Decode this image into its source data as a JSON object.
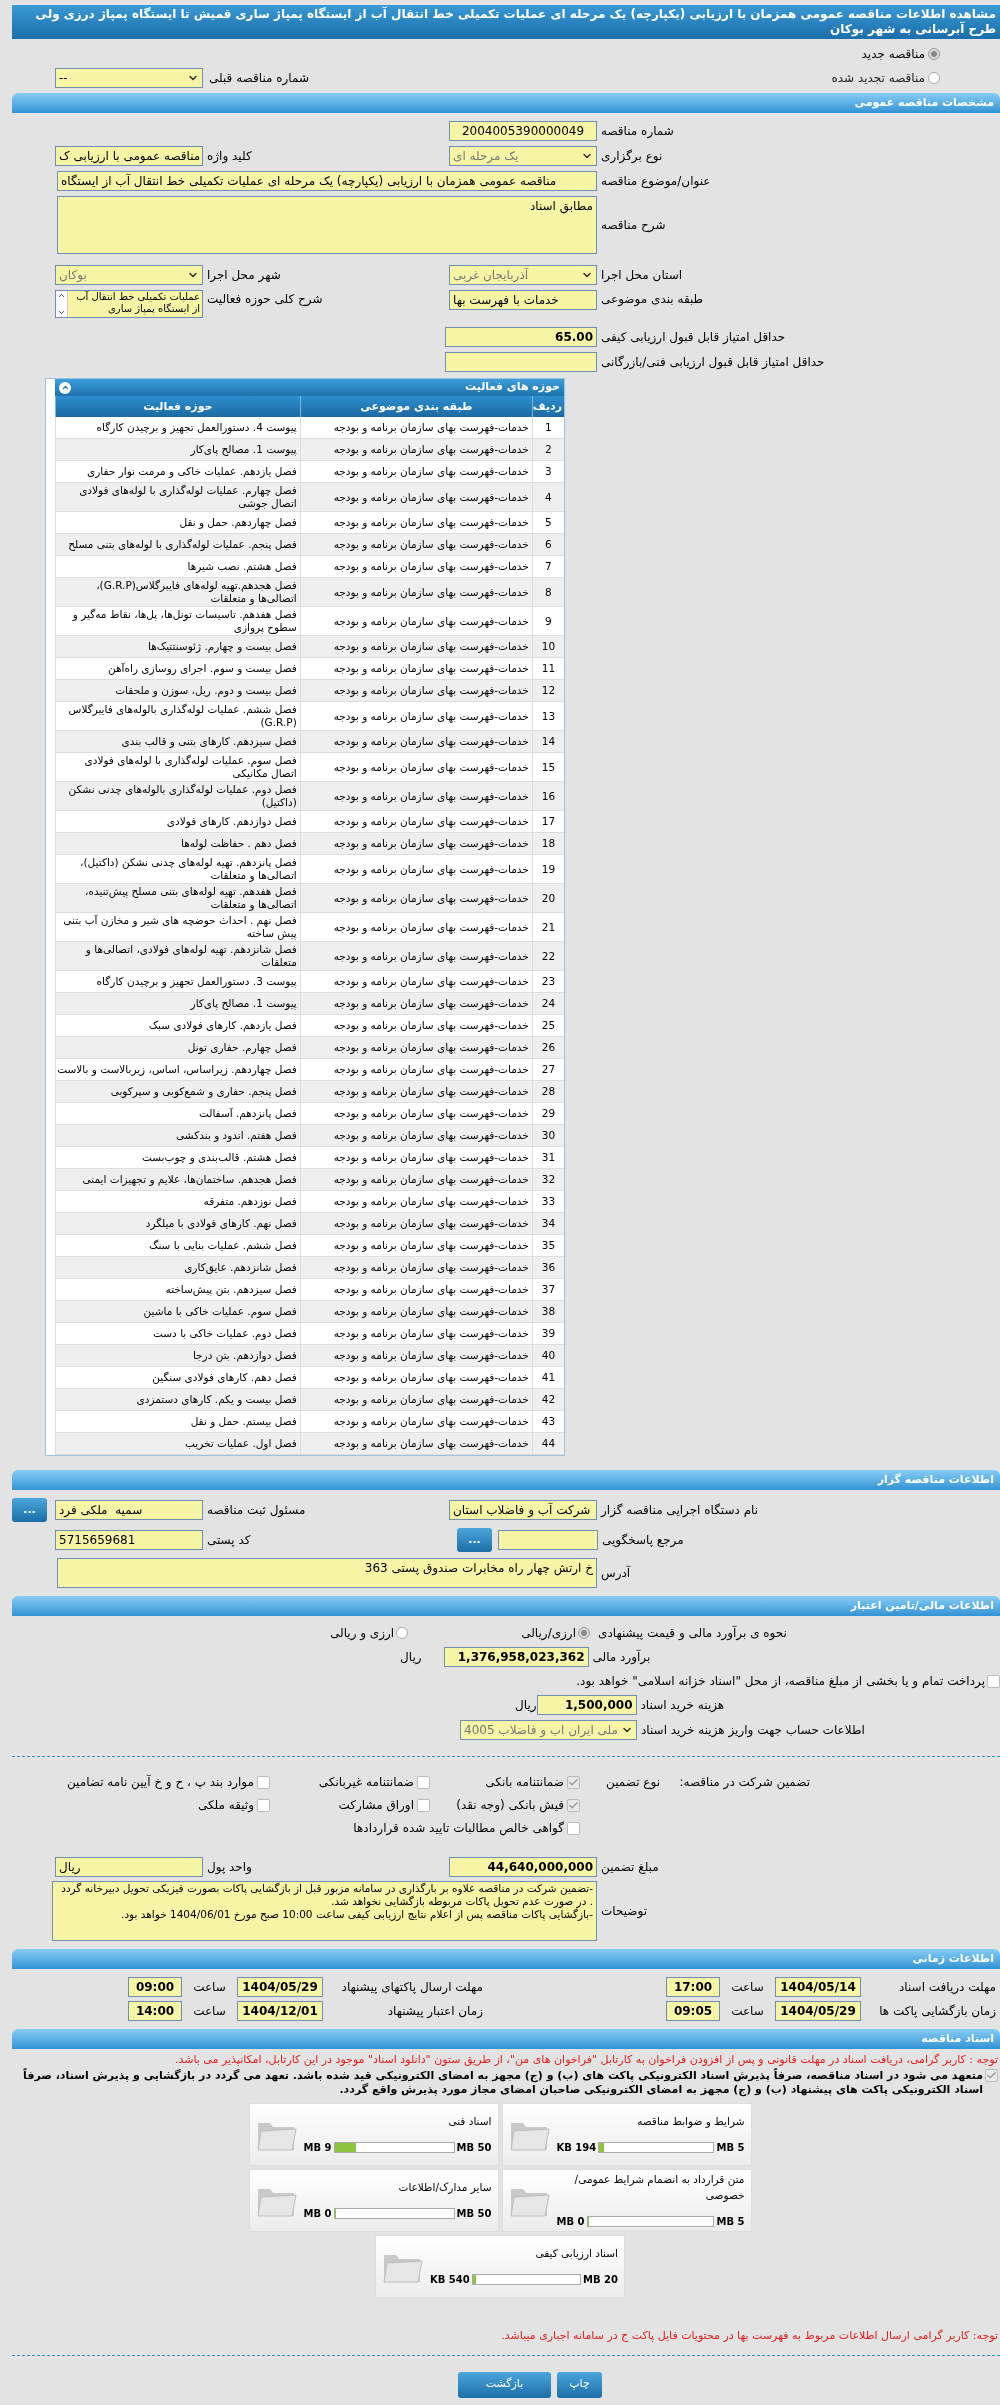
{
  "title": "مشاهده اطلاعات مناقصه عمومی همزمان با ارزیابی (یکپارچه) یک مرحله ای عملیات تکمیلی خط انتقال آب از ایستگاه پمپاژ ساری قمیش تا ایستگاه پمپاژ درزی ولی طرح آبرسانی به شهر بوکان",
  "tender_kind": [
    {
      "label": "مناقصه جدید",
      "selected": true
    },
    {
      "label": "مناقصه تجدید شده",
      "selected": false
    }
  ],
  "previous_tender": {
    "label": "شماره مناقصه قبلی",
    "value": "--"
  },
  "general": {
    "heading": "مشخصات مناقصه عمومی",
    "tender_number": {
      "label": "شماره مناقصه",
      "value": "2004005390000049"
    },
    "holding_type": {
      "label": "نوع برگزاری",
      "value": "یک مرحله ای"
    },
    "keyword": {
      "label": "کلید واژه",
      "value": "مناقصه عمومی با ارزیابی ک"
    },
    "subject": {
      "label": "عنوان/موضوع مناقصه",
      "value": "مناقصه عمومی همزمان با ارزیابی (یکپارچه) یک مرحله ای عملیات تکمیلی خط انتقال آب از ایستگاه"
    },
    "description": {
      "label": "شرح مناقصه",
      "value": "مطابق اسناد"
    },
    "province": {
      "label": "استان محل اجرا",
      "value": "آذربایجان غربی"
    },
    "city": {
      "label": "شهر محل اجرا",
      "value": "بوکان"
    },
    "category": {
      "label": "طبقه بندی موضوعی",
      "value": "خدمات با فهرست بها"
    },
    "activity_summary": {
      "label": "شرح کلی حوزه فعالیت",
      "value": "عملیات تکمیلی خط انتقال آب از ایستگاه پمپاژ ساری"
    },
    "min_quality_score": {
      "label": "حداقل امتیاز قابل قبول ارزیابی کیفی",
      "value": "65.00"
    },
    "min_technical_score": {
      "label": "حداقل امتیاز قابل قبول ارزیابی فنی/بازرگانی"
    }
  },
  "activities": {
    "heading": "حوزه های فعالیت",
    "columns": [
      "ردیف",
      "طبقه بندی موضوعی",
      "حوزه فعالیت"
    ],
    "rows": [
      {
        "number": "1",
        "category": "خدمات-فهرست بهای سازمان برنامه و بودجه",
        "activity": "پیوست 4. دستورالعمل تجهیز و برچیدن کارگاه"
      },
      {
        "number": "2",
        "category": "خدمات-فهرست بهای سازمان برنامه و بودجه",
        "activity": "پیوست 1. مصالح پای‌کار"
      },
      {
        "number": "3",
        "category": "خدمات-فهرست بهای سازمان برنامه و بودجه",
        "activity": "فصل یازدهم. عملیات خاکی و مرمت نوار حفاری"
      },
      {
        "number": "4",
        "category": "خدمات-فهرست بهای سازمان برنامه و بودجه",
        "activity": "فصل چهارم. عملیات لوله‌گذاری با لوله‌های فولادی اتصال جوشی"
      },
      {
        "number": "5",
        "category": "خدمات-فهرست بهای سازمان برنامه و بودجه",
        "activity": "فصل چهاردهم. حمل و نقل"
      },
      {
        "number": "6",
        "category": "خدمات-فهرست بهای سازمان برنامه و بودجه",
        "activity": "فصل پنجم. عملیات لوله‌گذاری با لوله‌های بتنی مسلح"
      },
      {
        "number": "7",
        "category": "خدمات-فهرست بهای سازمان برنامه و بودجه",
        "activity": "فصل هشتم. نصب شیرها"
      },
      {
        "number": "8",
        "category": "خدمات-فهرست بهای سازمان برنامه و بودجه",
        "activity": "فصل هجدهم.تهیه لوله‌های فایبرگلاس(G.R.P)، اتصالی‌ها و متعلقات"
      },
      {
        "number": "9",
        "category": "خدمات-فهرست بهای سازمان برنامه و بودجه",
        "activity": "فصل هفدهم. تاسیسات تونل‌ها، پل‌ها، نقاط مه‌گیر و سطوح پروازی"
      },
      {
        "number": "10",
        "category": "خدمات-فهرست بهای سازمان برنامه و بودجه",
        "activity": "فصل بیست و چهارم. ژئوسنتتیک‌ها"
      },
      {
        "number": "11",
        "category": "خدمات-فهرست بهای سازمان برنامه و بودجه",
        "activity": "فصل بیست و سوم. اجرای روسازی راه‌آهن"
      },
      {
        "number": "12",
        "category": "خدمات-فهرست بهای سازمان برنامه و بودجه",
        "activity": "فصل بیست و دوم. ریل، سوزن و ملحقات"
      },
      {
        "number": "13",
        "category": "خدمات-فهرست بهای سازمان برنامه و بودجه",
        "activity": "فصل ششم. عملیات لوله‌گذاری بالوله‌های فایبرگلاس (G.R.P)"
      },
      {
        "number": "14",
        "category": "خدمات-فهرست بهای سازمان برنامه و بودجه",
        "activity": "فصل سیزدهم. کارهای بتنی و قالب بندی"
      },
      {
        "number": "15",
        "category": "خدمات-فهرست بهای سازمان برنامه و بودجه",
        "activity": "فصل سوم. عملیات لوله‌گذاری با لوله‌های فولادی اتصال مکانیکی"
      },
      {
        "number": "16",
        "category": "خدمات-فهرست بهای سازمان برنامه و بودجه",
        "activity": "فصل دوم. عملیات لوله‌گذاری بالوله‌های چدنی نشکن (داکتیل)"
      },
      {
        "number": "17",
        "category": "خدمات-فهرست بهای سازمان برنامه و بودجه",
        "activity": "فصل دوازدهم. کارهای فولادی"
      },
      {
        "number": "18",
        "category": "خدمات-فهرست بهای سازمان برنامه و بودجه",
        "activity": "فصل دهم . حفاظت لوله‌ها"
      },
      {
        "number": "19",
        "category": "خدمات-فهرست بهای سازمان برنامه و بودجه",
        "activity": "فصل پانزدهم. تهیه لوله‌های چدنی نشکن (داکتیل)، اتصالی‌ها و متعلقات"
      },
      {
        "number": "20",
        "category": "خدمات-فهرست بهای سازمان برنامه و بودجه",
        "activity": "فصل هفدهم. تهیه لوله‌های بتنی مسلح پیش‌تنیده، اتصالی‌ها و متعلقات"
      },
      {
        "number": "21",
        "category": "خدمات-فهرست بهای سازمان برنامه و بودجه",
        "activity": "فصل نهم . احداث حوضچه های شیر و مخازن آب بتنی پیش ساخته"
      },
      {
        "number": "22",
        "category": "خدمات-فهرست بهای سازمان برنامه و بودجه",
        "activity": "فصل شانزدهم. تهیه لوله‌های فولادی، اتصالی‌ها و متعلقات"
      },
      {
        "number": "23",
        "category": "خدمات-فهرست بهای سازمان برنامه و بودجه",
        "activity": "پیوست 3. دستورالعمل تجهیز و برچیدن کارگاه"
      },
      {
        "number": "24",
        "category": "خدمات-فهرست بهای سازمان برنامه و بودجه",
        "activity": "پیوست 1. مصالح پای‌کار"
      },
      {
        "number": "25",
        "category": "خدمات-فهرست بهای سازمان برنامه و بودجه",
        "activity": "فصل یازدهم. کارهای فولادی سبک"
      },
      {
        "number": "26",
        "category": "خدمات-فهرست بهای سازمان برنامه و بودجه",
        "activity": "فصل چهارم. حفاری تونل"
      },
      {
        "number": "27",
        "category": "خدمات-فهرست بهای سازمان برنامه و بودجه",
        "activity": "فصل چهاردهم. زیراساس، اساس، زیربالاست و بالاست"
      },
      {
        "number": "28",
        "category": "خدمات-فهرست بهای سازمان برنامه و بودجه",
        "activity": "فصل پنجم. حفاری و شمع‌کوبی و سپرکوبی"
      },
      {
        "number": "29",
        "category": "خدمات-فهرست بهای سازمان برنامه و بودجه",
        "activity": "فصل پانزدهم. آسفالت"
      },
      {
        "number": "30",
        "category": "خدمات-فهرست بهای سازمان برنامه و بودجه",
        "activity": "فصل هفتم. اندود و بندکشی"
      },
      {
        "number": "31",
        "category": "خدمات-فهرست بهای سازمان برنامه و بودجه",
        "activity": "فصل هشتم. قالب‌بندی و چوب‌بست"
      },
      {
        "number": "32",
        "category": "خدمات-فهرست بهای سازمان برنامه و بودجه",
        "activity": "فصل هجدهم. ساختمان‌ها، علایم و تجهیزات ایمنی"
      },
      {
        "number": "33",
        "category": "خدمات-فهرست بهای سازمان برنامه و بودجه",
        "activity": "فصل نوزدهم. متفرقه"
      },
      {
        "number": "34",
        "category": "خدمات-فهرست بهای سازمان برنامه و بودجه",
        "activity": "فصل نهم. کارهای فولادی با میلگرد"
      },
      {
        "number": "35",
        "category": "خدمات-فهرست بهای سازمان برنامه و بودجه",
        "activity": "فصل ششم. عملیات بنایی با سنگ"
      },
      {
        "number": "36",
        "category": "خدمات-فهرست بهای سازمان برنامه و بودجه",
        "activity": "فصل شانزدهم. عایق‌کاری"
      },
      {
        "number": "37",
        "category": "خدمات-فهرست بهای سازمان برنامه و بودجه",
        "activity": "فصل سیزدهم. بتن پیش‌ساخته"
      },
      {
        "number": "38",
        "category": "خدمات-فهرست بهای سازمان برنامه و بودجه",
        "activity": "فصل سوم. عملیات خاکی با ماشین"
      },
      {
        "number": "39",
        "category": "خدمات-فهرست بهای سازمان برنامه و بودجه",
        "activity": "فصل دوم. عملیات خاکی با دست"
      },
      {
        "number": "40",
        "category": "خدمات-فهرست بهای سازمان برنامه و بودجه",
        "activity": "فصل دوازدهم. بتن درجا"
      },
      {
        "number": "41",
        "category": "خدمات-فهرست بهای سازمان برنامه و بودجه",
        "activity": "فصل دهم. کارهای فولادی سنگین"
      },
      {
        "number": "42",
        "category": "خدمات-فهرست بهای سازمان برنامه و بودجه",
        "activity": "فصل بیست و یکم. کارهای دستمزدی"
      },
      {
        "number": "43",
        "category": "خدمات-فهرست بهای سازمان برنامه و بودجه",
        "activity": "فصل بیستم. حمل و نقل"
      },
      {
        "number": "44",
        "category": "خدمات-فهرست بهای سازمان برنامه و بودجه",
        "activity": "فصل اول. عملیات تخریب"
      }
    ]
  },
  "organizer": {
    "heading": "اطلاعات مناقصه گزار",
    "agency": {
      "label": "نام دستگاه اجرایی مناقصه گزار",
      "value": "شرکت آب و فاضلاب استان"
    },
    "registrar": {
      "label": "مسئول ثبت مناقصه",
      "value": "سمیه  ملکی فرد",
      "button": "..."
    },
    "reference": {
      "label": "مرجع پاسخگویی",
      "button": "..."
    },
    "postal_code": {
      "label": "کد پستی",
      "value": "5715659681"
    },
    "address": {
      "label": "آدرس",
      "value": "خ ارتش چهار راه مخابرات صندوق پستی 363"
    }
  },
  "finance": {
    "heading": "اطلاعات مالی/تامین اعتبار",
    "estimate_method": {
      "label": "نحوه ی برآورد مالی و قیمت پیشنهادی",
      "options": [
        {
          "label": "ارزی/ریالی",
          "selected": true
        },
        {
          "label": "ارزی و ریالی",
          "selected": false
        }
      ]
    },
    "estimate": {
      "label": "برآورد مالی",
      "value": "1,376,958,023,362",
      "unit": "ریال"
    },
    "treasury": {
      "label": "پرداخت تمام و یا بخشی از مبلغ مناقصه، از محل \"اسناد خزانه اسلامی\" خواهد بود.",
      "checked": false
    },
    "document_fee": {
      "label": "هزینه خرید اسناد",
      "value": "1,500,000",
      "unit": "ریال"
    },
    "account": {
      "label": "اطلاعات حساب جهت واریز هزینه خرید اسناد",
      "value": "ملی ایران اب و فاضلاب 4005"
    }
  },
  "guarantee": {
    "title": "تضمین شرکت در مناقصه:",
    "type_label": "نوع تضمین",
    "options": [
      {
        "label": "ضمانتنامه بانکی",
        "checked": true
      },
      {
        "label": "ضمانتنامه غیربانکی",
        "checked": false
      },
      {
        "label": "موارد بند پ ، ح و خ آیین نامه تضامین",
        "checked": false
      },
      {
        "label": "فیش بانکی (وجه نقد)",
        "checked": true
      },
      {
        "label": "اوراق مشارکت",
        "checked": false
      },
      {
        "label": "وثیقه ملکی",
        "checked": false
      },
      {
        "label": "گواهی خالص مطالبات تایید شده قراردادها",
        "checked": false
      }
    ],
    "amount": {
      "label": "مبلغ تضمین",
      "value": "44,640,000,000"
    },
    "currency": {
      "label": "واحد پول",
      "value": "ریال"
    },
    "notes": {
      "label": "توضیحات",
      "lines": [
        "-تضمین شرکت در مناقصه علاوه بر بارگذاری در سامانه مزبور قبل از بازگشایی پاکات بصورت فیزیکی تحویل دبیرخانه گردد . در صورت عدم تحویل پاکات مربوطه بازگشایی نخواهد شد.",
        "-بازگشایی پاکات مناقصه پس از اعلام نتایج ارزیابی کیفی ساعت 10:00 صبح مورخ 1404/06/01 خواهد بود."
      ]
    }
  },
  "schedule": {
    "heading": "اطلاعات زمانی",
    "items": [
      {
        "label": "مهلت دریافت اسناد",
        "date": "1404/05/14",
        "time_label": "ساعت",
        "time": "17:00"
      },
      {
        "label": "مهلت ارسال پاکتهای پیشنهاد",
        "date": "1404/05/29",
        "time_label": "ساعت",
        "time": "09:00"
      },
      {
        "label": "زمان بازگشایی پاکت ها",
        "date": "1404/05/29",
        "time_label": "ساعت",
        "time": "09:05"
      },
      {
        "label": "زمان اعتبار پیشنهاد",
        "date": "1404/12/01",
        "time_label": "ساعت",
        "time": "14:00"
      }
    ]
  },
  "documents": {
    "heading": "اسناد مناقصه",
    "notice": "توجه : کاربر گرامی، دریافت اسناد در مهلت قانونی و پس از افزودن فراخوان به کارتابل \"فراخوان های من\"، از طریق ستون \"دانلود اسناد\" موجود در این کارتابل، امکانپذیر می باشد.",
    "commitment": {
      "label": "متعهد می شود در اسناد مناقصه، صرفاً پذیرش اسناد الکترونیکی پاکت های (ب) و (ج) مجهز به امضای الکترونیکی قید شده باشد. تعهد می گردد در بازگشایی و پذیرش اسناد، صرفاً اسناد الکترونیکی پاکت های پیشنهاد (ب) و (ج) مجهز به امضای الکترونیکی صاحبان امضای مجاز مورد پذیرش واقع گردد.",
      "checked": true
    },
    "files": [
      {
        "name": "شرایط و ضوابط مناقصه",
        "used": "194 KB",
        "max": "5 MB",
        "level": 0.04
      },
      {
        "name": "اسناد فنی",
        "used": "9 MB",
        "max": "50 MB",
        "level": 0.18
      },
      {
        "name": "متن قرارداد به انضمام شرایط عمومی/خصوصی",
        "used": "0 MB",
        "max": "5 MB",
        "level": 0
      },
      {
        "name": "سایر مدارک/اطلاعات",
        "used": "0 MB",
        "max": "50 MB",
        "level": 0
      },
      {
        "name": "اسناد ارزیابی کیفی",
        "used": "540 KB",
        "max": "20 MB",
        "level": 0.027
      }
    ],
    "footer_notice": "توجه: کاربر گرامی ارسال اطلاعات مربوط به فهرست بها در محتویات فایل پاکت ج در سامانه اجباری میباشد."
  },
  "buttons": [
    "چاپ",
    "بازگشت"
  ]
}
